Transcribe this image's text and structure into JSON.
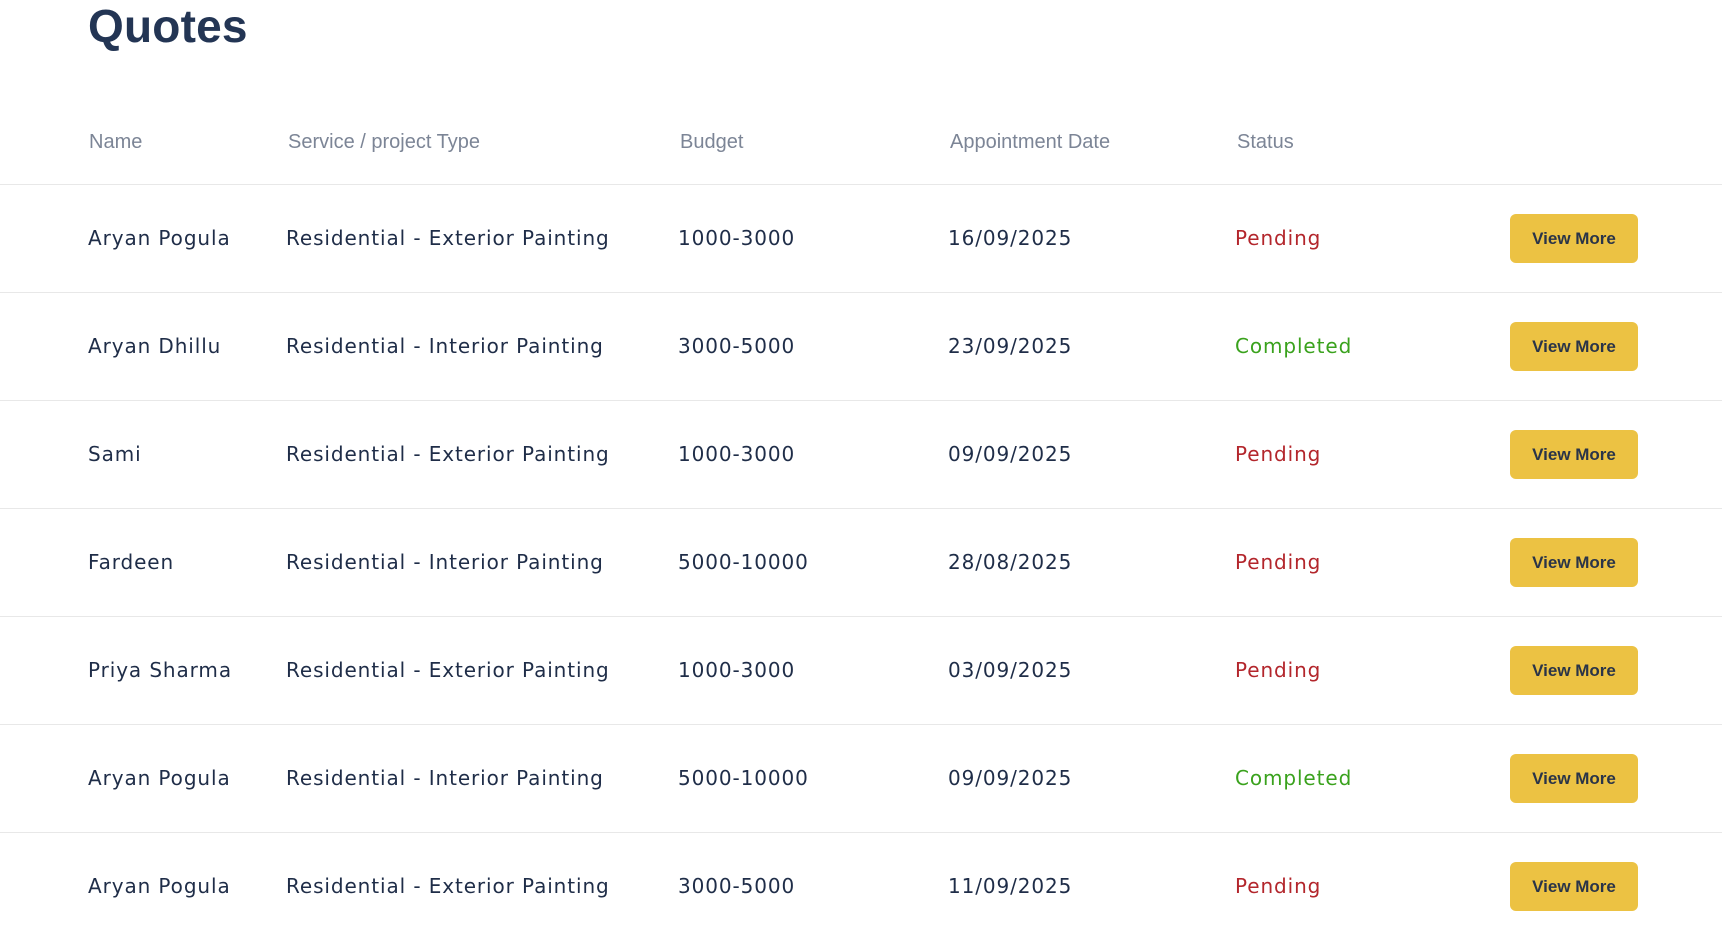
{
  "page": {
    "title": "Quotes"
  },
  "table": {
    "columns": {
      "name": "Name",
      "service": "Service / project Type",
      "budget": "Budget",
      "date": "Appointment Date",
      "status": "Status"
    },
    "rows": [
      {
        "name": "Aryan Pogula",
        "service": "Residential - Exterior Painting",
        "budget": "1000-3000",
        "date": "16/09/2025",
        "status": "Pending",
        "action": "View More"
      },
      {
        "name": "Aryan Dhillu",
        "service": "Residential - Interior Painting",
        "budget": "3000-5000",
        "date": "23/09/2025",
        "status": "Completed",
        "action": "View More"
      },
      {
        "name": "Sami",
        "service": "Residential - Exterior Painting",
        "budget": "1000-3000",
        "date": "09/09/2025",
        "status": "Pending",
        "action": "View More"
      },
      {
        "name": "Fardeen",
        "service": "Residential - Interior Painting",
        "budget": "5000-10000",
        "date": "28/08/2025",
        "status": "Pending",
        "action": "View More"
      },
      {
        "name": "Priya Sharma",
        "service": "Residential - Exterior Painting",
        "budget": "1000-3000",
        "date": "03/09/2025",
        "status": "Pending",
        "action": "View More"
      },
      {
        "name": "Aryan Pogula",
        "service": "Residential - Interior Painting",
        "budget": "5000-10000",
        "date": "09/09/2025",
        "status": "Completed",
        "action": "View More"
      },
      {
        "name": "Aryan Pogula",
        "service": "Residential - Exterior Painting",
        "budget": "3000-5000",
        "date": "11/09/2025",
        "status": "Pending",
        "action": "View More"
      }
    ]
  },
  "colors": {
    "pending": "#b3262c",
    "completed": "#3aa21d",
    "button": "#ecc243",
    "title": "#233554"
  }
}
